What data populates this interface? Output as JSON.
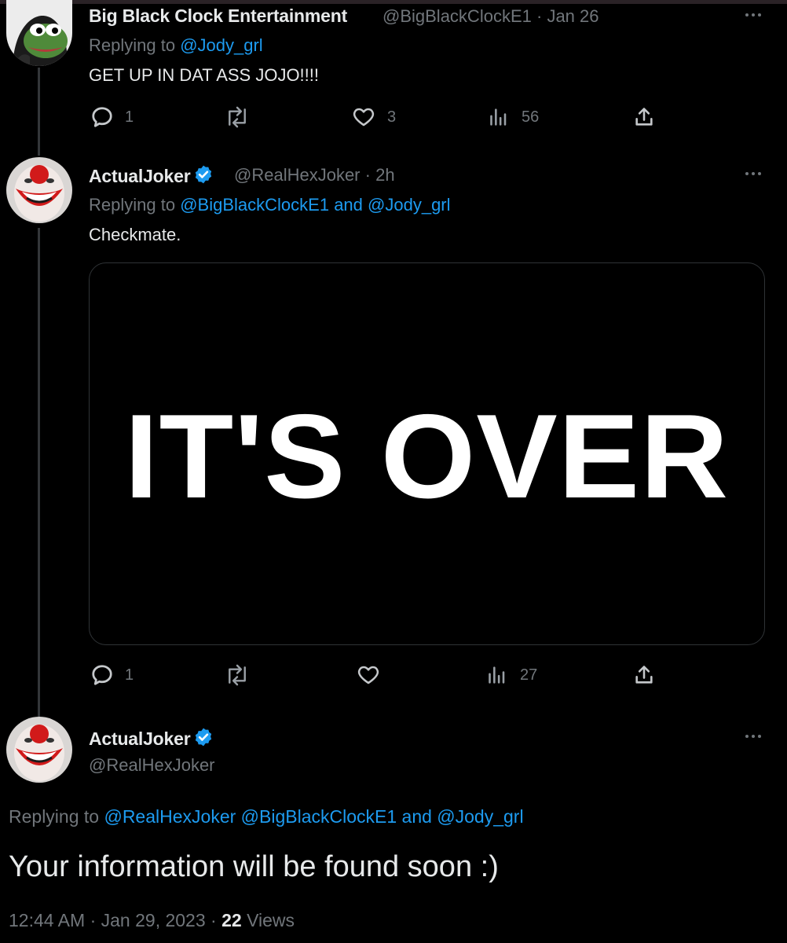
{
  "tweet1": {
    "name": "Big Black Clock Entertainment",
    "handle": "@BigBlackClockE1",
    "date": "Jan 26",
    "replying_prefix": "Replying to",
    "replying_users": [
      "@Jody_grl"
    ],
    "text": "GET UP IN DAT ASS JOJO!!!!",
    "actions": {
      "replies": "1",
      "retweets": "",
      "likes": "3",
      "views": "56"
    }
  },
  "tweet2": {
    "name": "ActualJoker",
    "handle": "@RealHexJoker",
    "time": "2h",
    "replying_prefix": "Replying to",
    "replying_users": [
      "@BigBlackClockE1",
      "@Jody_grl"
    ],
    "replying_and": "and",
    "text": "Checkmate.",
    "media_text": "IT'S OVER",
    "actions": {
      "replies": "1",
      "retweets": "",
      "likes": "",
      "views": "27"
    }
  },
  "main_tweet": {
    "name": "ActualJoker",
    "handle": "@RealHexJoker",
    "replying_prefix": "Replying to",
    "replying_users": [
      "@RealHexJoker",
      "@BigBlackClockE1",
      "@Jody_grl"
    ],
    "replying_and": "and",
    "text": "Your information will be found soon :)",
    "time": "12:44 AM",
    "date": "Jan 29, 2023",
    "views_count": "22",
    "views_label": "Views"
  },
  "separator": "·",
  "icons": {
    "reply": "reply-icon",
    "retweet": "retweet-icon",
    "like": "heart-icon",
    "views": "views-icon",
    "share": "share-icon",
    "verified": "verified-badge-icon",
    "more": "more-icon"
  },
  "colors": {
    "background": "#000000",
    "text": "#e7e9ea",
    "muted": "#71767b",
    "link": "#1d9bf0",
    "verified": "#1d9bf0"
  }
}
